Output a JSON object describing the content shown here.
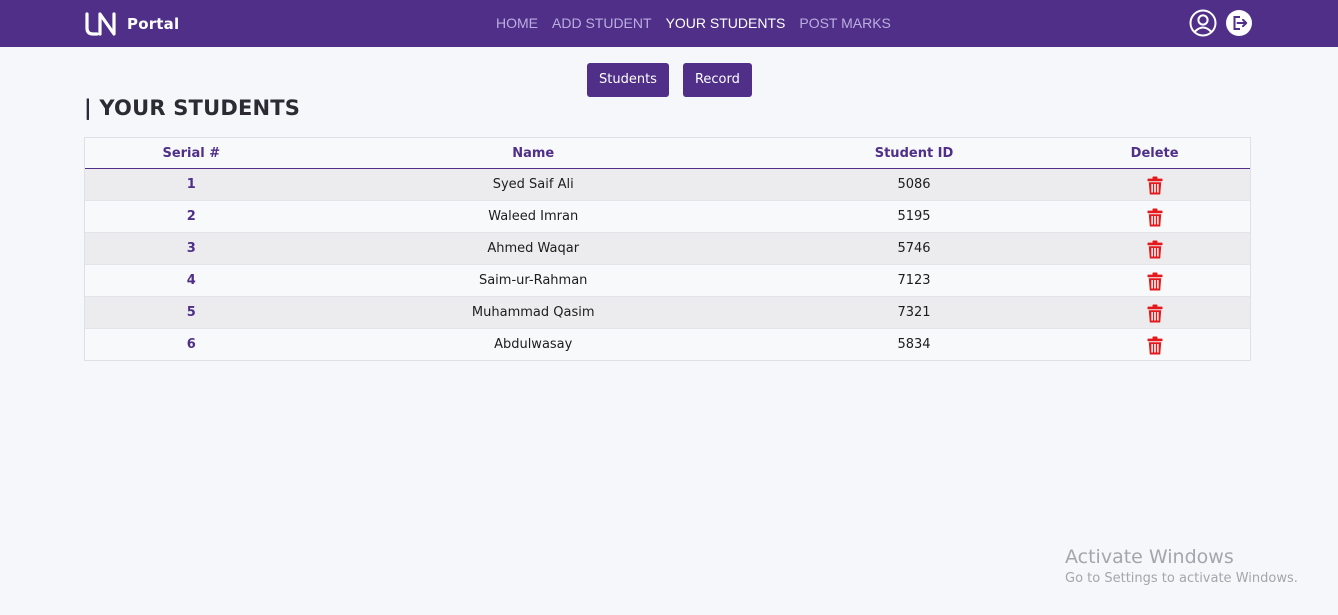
{
  "brand": {
    "logo_text": "Portal"
  },
  "nav": {
    "links": [
      {
        "label": "HOME",
        "active": false
      },
      {
        "label": "ADD STUDENT",
        "active": false
      },
      {
        "label": "YOUR STUDENTS",
        "active": true
      },
      {
        "label": "POST MARKS",
        "active": false
      }
    ],
    "icons": [
      "user-profile-icon",
      "logout-icon"
    ]
  },
  "actions": {
    "students_label": "Students",
    "record_label": "Record"
  },
  "page": {
    "title": "| YOUR STUDENTS"
  },
  "table": {
    "headers": [
      "Serial #",
      "Name",
      "Student ID",
      "Delete"
    ],
    "rows": [
      {
        "serial": "1",
        "name": "Syed Saif Ali",
        "student_id": "5086"
      },
      {
        "serial": "2",
        "name": "Waleed Imran",
        "student_id": "5195"
      },
      {
        "serial": "3",
        "name": "Ahmed Waqar",
        "student_id": "5746"
      },
      {
        "serial": "4",
        "name": "Saim-ur-Rahman",
        "student_id": "7123"
      },
      {
        "serial": "5",
        "name": "Muhammad Qasim",
        "student_id": "7321"
      },
      {
        "serial": "6",
        "name": "Abdulwasay",
        "student_id": "5834"
      }
    ],
    "delete_icon": "trash-icon"
  },
  "watermark": {
    "title": "Activate Windows",
    "subtitle": "Go to Settings to activate Windows."
  },
  "colors": {
    "brand": "#4f2f88",
    "delete": "#e3191c",
    "nav_inactive": "#bcaee0"
  }
}
